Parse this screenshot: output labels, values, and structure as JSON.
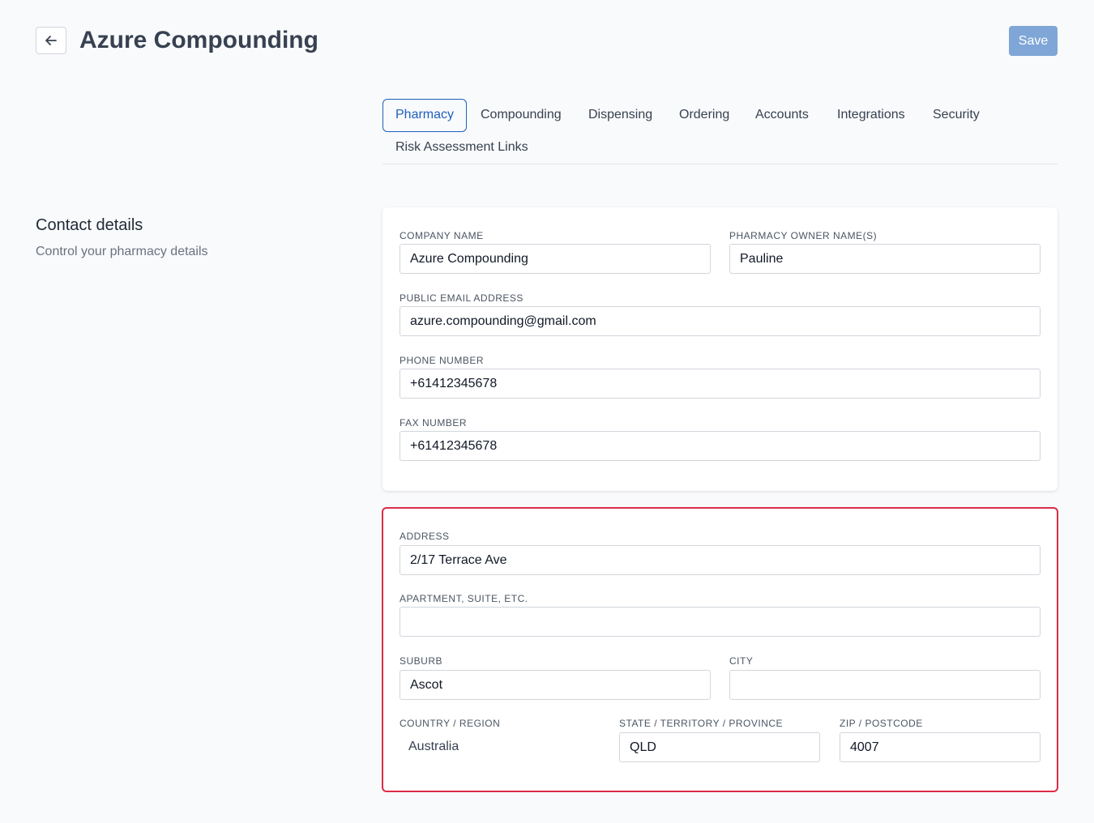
{
  "header": {
    "title": "Azure Compounding",
    "save_label": "Save"
  },
  "tabs": [
    {
      "label": "Pharmacy",
      "active": true
    },
    {
      "label": "Compounding"
    },
    {
      "label": "Dispensing"
    },
    {
      "label": "Ordering"
    },
    {
      "label": "Accounts"
    },
    {
      "label": "Integrations"
    },
    {
      "label": "Security"
    },
    {
      "label": "Risk Assessment Links"
    }
  ],
  "section": {
    "title": "Contact details",
    "subtitle": "Control your pharmacy details"
  },
  "contact": {
    "company_name": {
      "label": "COMPANY NAME",
      "value": "Azure Compounding"
    },
    "owner_names": {
      "label": "PHARMACY OWNER NAME(S)",
      "value": "Pauline"
    },
    "email": {
      "label": "PUBLIC EMAIL ADDRESS",
      "value": "azure.compounding@gmail.com"
    },
    "phone": {
      "label": "PHONE NUMBER",
      "value": "+61412345678"
    },
    "fax": {
      "label": "FAX NUMBER",
      "value": "+61412345678"
    }
  },
  "address": {
    "address": {
      "label": "ADDRESS",
      "value": "2/17 Terrace Ave"
    },
    "apartment": {
      "label": "APARTMENT, SUITE, ETC.",
      "value": ""
    },
    "suburb": {
      "label": "SUBURB",
      "value": "Ascot"
    },
    "city": {
      "label": "CITY",
      "value": ""
    },
    "country": {
      "label": "COUNTRY / REGION",
      "value": "Australia"
    },
    "state": {
      "label": "STATE / TERRITORY / PROVINCE",
      "value": "QLD"
    },
    "zip": {
      "label": "ZIP / POSTCODE",
      "value": "4007"
    }
  },
  "colors": {
    "accent": "#1f5fbf",
    "save_button": "#7fa6d6",
    "highlight_border": "#dc2c47"
  },
  "icons": {
    "back": "arrow-left-icon"
  }
}
